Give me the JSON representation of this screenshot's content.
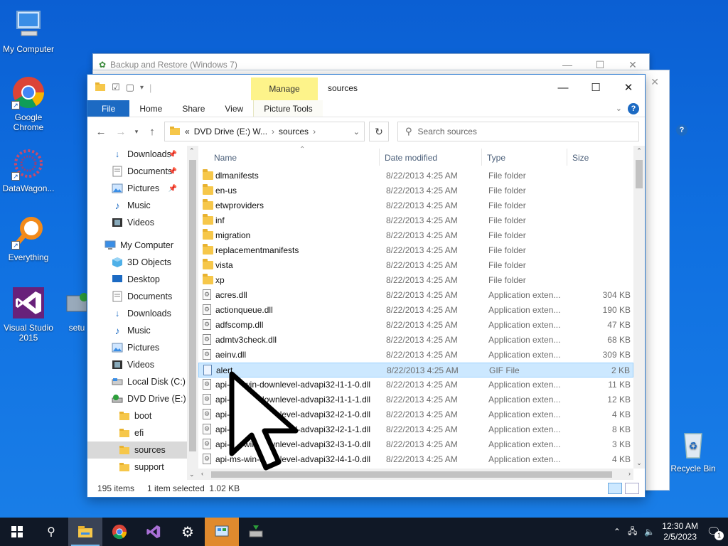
{
  "desktop": {
    "icons": [
      {
        "label": "My Computer"
      },
      {
        "label": "Google Chrome"
      },
      {
        "label": "DataWagon..."
      },
      {
        "label": "Everything"
      },
      {
        "label": "Visual Studio 2015"
      },
      {
        "label": "setu"
      },
      {
        "label": "Recycle Bin"
      }
    ]
  },
  "bg_window": {
    "title": "Backup and Restore (Windows 7)"
  },
  "explorer": {
    "title": "sources",
    "manage_tab": "Manage",
    "tabs": {
      "file": "File",
      "home": "Home",
      "share": "Share",
      "view": "View",
      "picture_tools": "Picture Tools"
    },
    "address": {
      "prefix": "«",
      "drive": "DVD Drive (E:) W...",
      "sep": "›",
      "folder": "sources"
    },
    "search_placeholder": "Search sources",
    "nav": [
      {
        "label": "Downloads",
        "icon": "download-arrow-icon",
        "pinned": true
      },
      {
        "label": "Documents",
        "icon": "documents-icon",
        "pinned": true
      },
      {
        "label": "Pictures",
        "icon": "pictures-icon",
        "pinned": true
      },
      {
        "label": "Music",
        "icon": "music-note-icon",
        "pinned": false
      },
      {
        "label": "Videos",
        "icon": "videos-icon",
        "pinned": false
      },
      {
        "label": "My Computer",
        "icon": "computer-icon",
        "pinned": false
      },
      {
        "label": "3D Objects",
        "icon": "cube-icon",
        "pinned": false
      },
      {
        "label": "Desktop",
        "icon": "desktop-icon",
        "pinned": false
      },
      {
        "label": "Documents",
        "icon": "documents-icon",
        "pinned": false
      },
      {
        "label": "Downloads",
        "icon": "download-arrow-icon",
        "pinned": false
      },
      {
        "label": "Music",
        "icon": "music-note-icon",
        "pinned": false
      },
      {
        "label": "Pictures",
        "icon": "pictures-icon",
        "pinned": false
      },
      {
        "label": "Videos",
        "icon": "videos-icon",
        "pinned": false
      },
      {
        "label": "Local Disk (C:)",
        "icon": "disk-icon",
        "pinned": false
      },
      {
        "label": "DVD Drive (E:) W",
        "icon": "dvd-icon",
        "pinned": false
      },
      {
        "label": "boot",
        "icon": "folder-icon",
        "pinned": false
      },
      {
        "label": "efi",
        "icon": "folder-icon",
        "pinned": false
      },
      {
        "label": "sources",
        "icon": "folder-icon",
        "pinned": false,
        "selected": true
      },
      {
        "label": "support",
        "icon": "folder-icon",
        "pinned": false
      }
    ],
    "columns": {
      "name": "Name",
      "date": "Date modified",
      "type": "Type",
      "size": "Size"
    },
    "files": [
      {
        "name": "dlmanifests",
        "date": "8/22/2013 4:25 AM",
        "type": "File folder",
        "size": "",
        "kind": "folder"
      },
      {
        "name": "en-us",
        "date": "8/22/2013 4:25 AM",
        "type": "File folder",
        "size": "",
        "kind": "folder"
      },
      {
        "name": "etwproviders",
        "date": "8/22/2013 4:25 AM",
        "type": "File folder",
        "size": "",
        "kind": "folder"
      },
      {
        "name": "inf",
        "date": "8/22/2013 4:25 AM",
        "type": "File folder",
        "size": "",
        "kind": "folder"
      },
      {
        "name": "migration",
        "date": "8/22/2013 4:25 AM",
        "type": "File folder",
        "size": "",
        "kind": "folder"
      },
      {
        "name": "replacementmanifests",
        "date": "8/22/2013 4:25 AM",
        "type": "File folder",
        "size": "",
        "kind": "folder"
      },
      {
        "name": "vista",
        "date": "8/22/2013 4:25 AM",
        "type": "File folder",
        "size": "",
        "kind": "folder"
      },
      {
        "name": "xp",
        "date": "8/22/2013 4:25 AM",
        "type": "File folder",
        "size": "",
        "kind": "folder"
      },
      {
        "name": "acres.dll",
        "date": "8/22/2013 4:25 AM",
        "type": "Application exten...",
        "size": "304 KB",
        "kind": "dll"
      },
      {
        "name": "actionqueue.dll",
        "date": "8/22/2013 4:25 AM",
        "type": "Application exten...",
        "size": "190 KB",
        "kind": "dll"
      },
      {
        "name": "adfscomp.dll",
        "date": "8/22/2013 4:25 AM",
        "type": "Application exten...",
        "size": "47 KB",
        "kind": "dll"
      },
      {
        "name": "admtv3check.dll",
        "date": "8/22/2013 4:25 AM",
        "type": "Application exten...",
        "size": "68 KB",
        "kind": "dll"
      },
      {
        "name": "aeinv.dll",
        "date": "8/22/2013 4:25 AM",
        "type": "Application exten...",
        "size": "309 KB",
        "kind": "dll"
      },
      {
        "name": "alert",
        "date": "8/22/2013 4:25 AM",
        "type": "GIF File",
        "size": "2 KB",
        "kind": "gif",
        "selected": true
      },
      {
        "name": "api-ms-win-downlevel-advapi32-l1-1-0.dll",
        "date": "8/22/2013 4:25 AM",
        "type": "Application exten...",
        "size": "11 KB",
        "kind": "dll"
      },
      {
        "name": "api-ms-win-downlevel-advapi32-l1-1-1.dll",
        "date": "8/22/2013 4:25 AM",
        "type": "Application exten...",
        "size": "12 KB",
        "kind": "dll"
      },
      {
        "name": "api-ms-win-downlevel-advapi32-l2-1-0.dll",
        "date": "8/22/2013 4:25 AM",
        "type": "Application exten...",
        "size": "4 KB",
        "kind": "dll"
      },
      {
        "name": "api-ms-win-downlevel-advapi32-l2-1-1.dll",
        "date": "8/22/2013 4:25 AM",
        "type": "Application exten...",
        "size": "8 KB",
        "kind": "dll"
      },
      {
        "name": "api-ms-win-downlevel-advapi32-l3-1-0.dll",
        "date": "8/22/2013 4:25 AM",
        "type": "Application exten...",
        "size": "3 KB",
        "kind": "dll"
      },
      {
        "name": "api-ms-win-downlevel-advapi32-l4-1-0.dll",
        "date": "8/22/2013 4:25 AM",
        "type": "Application exten...",
        "size": "4 KB",
        "kind": "dll"
      }
    ],
    "status": {
      "count": "195 items",
      "selection": "1 item selected  1.02 KB"
    }
  },
  "taskbar": {
    "time": "12:30 AM",
    "date": "2/5/2023",
    "notifications": "1"
  },
  "colors": {
    "accent": "#1c6ac3",
    "manage_highlight": "#fdf38a",
    "selection": "#cce8ff",
    "taskbar": "#101826"
  }
}
